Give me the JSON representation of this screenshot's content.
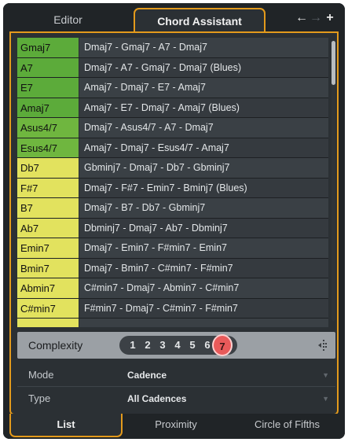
{
  "tabs": {
    "editor": "Editor",
    "chord_assistant": "Chord Assistant"
  },
  "nav": {
    "back": "←",
    "forward": "→",
    "add": "+"
  },
  "rows": [
    {
      "chord": "Gmaj7",
      "progression": "Dmaj7 - Gmaj7 - A7 - Dmaj7",
      "color": "#5cab3a"
    },
    {
      "chord": "A7",
      "progression": "Dmaj7 - A7 - Gmaj7 - Dmaj7 (Blues)",
      "color": "#5cab3a"
    },
    {
      "chord": "E7",
      "progression": "Amaj7 - Dmaj7 - E7 - Amaj7",
      "color": "#5cab3a"
    },
    {
      "chord": "Amaj7",
      "progression": "Amaj7 - E7 - Dmaj7 - Amaj7 (Blues)",
      "color": "#5cab3a"
    },
    {
      "chord": "Asus4/7",
      "progression": "Dmaj7 - Asus4/7 - A7 - Dmaj7",
      "color": "#6fb63f"
    },
    {
      "chord": "Esus4/7",
      "progression": "Amaj7 - Dmaj7 - Esus4/7 - Amaj7",
      "color": "#6fb63f"
    },
    {
      "chord": "Db7",
      "progression": "Gbminj7 - Dmaj7 - Db7 - Gbminj7",
      "color": "#e2e25e"
    },
    {
      "chord": "F#7",
      "progression": "Dmaj7 - F#7 - Emin7 - Bminj7 (Blues)",
      "color": "#e2e25e"
    },
    {
      "chord": "B7",
      "progression": "Dmaj7 - B7 - Db7 - Gbminj7",
      "color": "#e2e25e"
    },
    {
      "chord": "Ab7",
      "progression": "Dbminj7 - Dmaj7 - Ab7 - Dbminj7",
      "color": "#e2e25e"
    },
    {
      "chord": "Emin7",
      "progression": "Dmaj7 - Emin7 - F#min7 - Emin7",
      "color": "#e2e25e"
    },
    {
      "chord": "Bmin7",
      "progression": "Dmaj7 - Bmin7 - C#min7 - F#min7",
      "color": "#e2e25e"
    },
    {
      "chord": "Abmin7",
      "progression": "C#min7 - Dmaj7 - Abmin7 - C#min7",
      "color": "#e2e25e"
    },
    {
      "chord": "C#min7",
      "progression": "F#min7 - Dmaj7 - C#min7 - F#min7",
      "color": "#e2e25e"
    },
    {
      "chord": "",
      "progression": "",
      "color": "#e2e25e"
    }
  ],
  "scroll_position": 0,
  "complexity": {
    "label": "Complexity",
    "levels": [
      "1",
      "2",
      "3",
      "4",
      "5",
      "6",
      "7"
    ],
    "selected": 7
  },
  "mode": {
    "label": "Mode",
    "value": "Cadence"
  },
  "type": {
    "label": "Type",
    "value": "All Cadences"
  },
  "bottom_tabs": {
    "list": "List",
    "proximity": "Proximity",
    "circle": "Circle of Fifths"
  },
  "colors": {
    "accent": "#e39a1c",
    "selected_level": "#e85a5a",
    "green": "#5cab3a",
    "yellow": "#e2e25e"
  }
}
